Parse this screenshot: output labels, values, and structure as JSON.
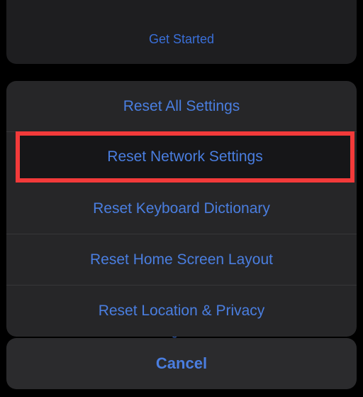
{
  "background": {
    "get_started_label": "Get Started",
    "erase_label": "Erase All Content and Settings"
  },
  "sheet": {
    "options": [
      {
        "label": "Reset All Settings"
      },
      {
        "label": "Reset Network Settings"
      },
      {
        "label": "Reset Keyboard Dictionary"
      },
      {
        "label": "Reset Home Screen Layout"
      },
      {
        "label": "Reset Location & Privacy"
      }
    ],
    "highlighted_index": 1,
    "cancel_label": "Cancel"
  }
}
